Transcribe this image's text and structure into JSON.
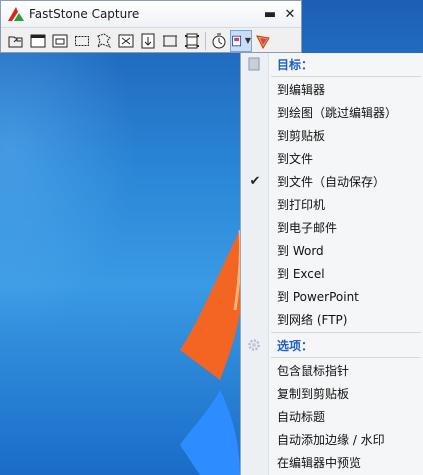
{
  "window": {
    "title": "FastStone Capture",
    "minimize_glyph": "▬",
    "close_glyph": "✕"
  },
  "toolbar": {
    "tools": [
      "open-file-icon",
      "capture-window-icon",
      "capture-object-icon",
      "capture-rectangle-icon",
      "capture-freehand-icon",
      "capture-fullscreen-icon",
      "capture-scrolling-icon",
      "capture-fixed-region-icon",
      "screen-recorder-icon",
      "delay-timer-icon",
      "output-destination-icon",
      "settings-icon"
    ]
  },
  "menu": {
    "target_header": "目标：",
    "targets": [
      "到编辑器",
      "到绘图（跳过编辑器）",
      "到剪贴板",
      "到文件",
      "到文件（自动保存）",
      "到打印机",
      "到电子邮件",
      "到 Word",
      "到 Excel",
      "到 PowerPoint",
      "到网络 (FTP)"
    ],
    "checked_index": 4,
    "check_glyph": "✔",
    "options_header": "选项：",
    "options": [
      "包含鼠标指针",
      "复制到剪贴板",
      "自动标题",
      "自动添加边缘 / 水印",
      "在编辑器中预览"
    ]
  },
  "colors": {
    "accent": "#1f5fbf",
    "desktop": "#2a85d6"
  }
}
